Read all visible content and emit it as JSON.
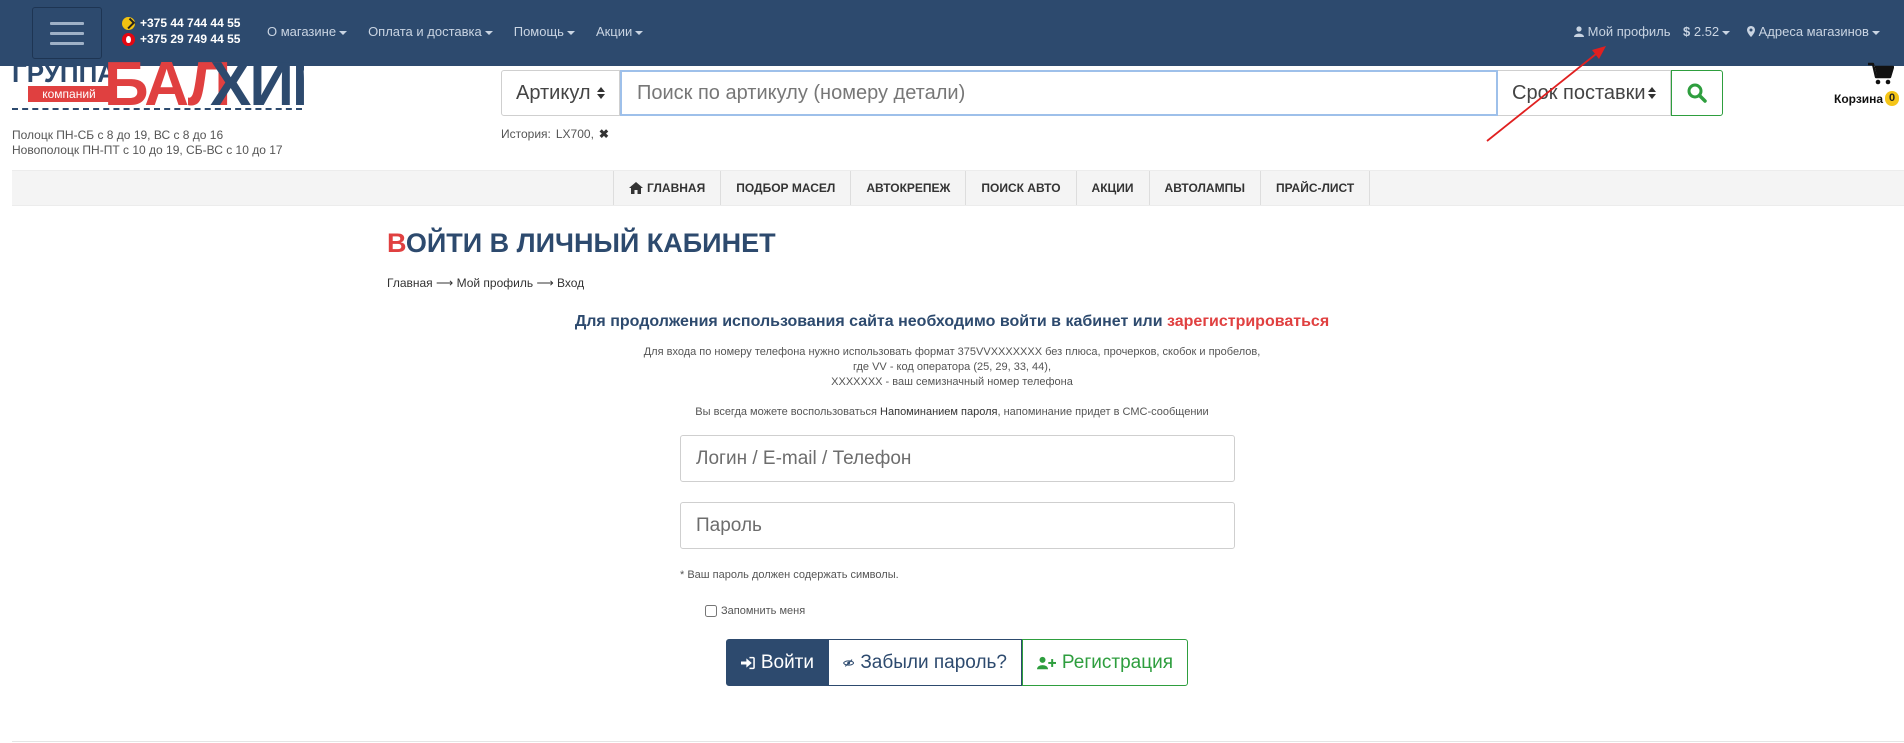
{
  "topbar": {
    "phones": [
      "+375 44 744 44 55",
      "+375 29 749 44 55"
    ],
    "nav": [
      "О магазине",
      "Оплата и доставка",
      "Помощь",
      "Акции"
    ],
    "profile": "Мой профиль",
    "currency": "2.52",
    "stores": "Адреса магазинов"
  },
  "logo": {
    "line1": "ГРУППА",
    "line2": "компаний",
    "brand_a": "БАЛ",
    "brand_b": "ХИМ"
  },
  "hours": [
    "Полоцк ПН-СБ с 8 до 19, ВС с 8 до 16",
    "Новополоцк ПН-ПТ с 10 до 19, СБ-ВС с 10 до 17"
  ],
  "search": {
    "type_selected": "Артикул",
    "placeholder": "Поиск по артикулу (номеру детали)",
    "term_selected": "Срок поставки"
  },
  "history": {
    "label": "История:",
    "items": [
      "LX700,"
    ]
  },
  "cart": {
    "label": "Корзина",
    "count": "0"
  },
  "menu": [
    "ГЛАВНАЯ",
    "ПОДБОР МАСЕЛ",
    "АВТОКРЕПЕЖ",
    "ПОИСК АВТО",
    "АКЦИИ",
    "АВТОЛАМПЫ",
    "ПРАЙС-ЛИСТ"
  ],
  "page": {
    "title_first": "В",
    "title_rest": "ОЙТИ В ЛИЧНЫЙ КАБИНЕТ",
    "breadcrumb": [
      "Главная",
      "Мой профиль",
      "Вход"
    ],
    "lead": "Для продолжения использования сайта необходимо войти в кабинет или",
    "lead_link": "зарегистрироваться",
    "info": [
      "Для входа по номеру телефона нужно использовать формат 375VVXXXXXXX без плюса, прочерков, скобок и пробелов,",
      "где VV - код оператора (25, 29, 33, 44),",
      "XXXXXXX - ваш семизначный номер телефона"
    ],
    "remind_pre": "Вы всегда можете воспользоваться",
    "remind_link": "Напоминанием пароля",
    "remind_post": ", напоминание придет в СМС-сообщении",
    "login_placeholder": "Логин / E-mail / Телефон",
    "password_placeholder": "Пароль",
    "hint": "* Ваш пароль должен содержать символы.",
    "remember": "Запомнить меня",
    "btn_login": "Войти",
    "btn_forgot": "Забыли пароль?",
    "btn_register": "Регистрация"
  },
  "colors": {
    "navy": "#2d4a6e",
    "red": "#e04040",
    "green": "#2e9e3e",
    "arrow": "#e02020"
  }
}
